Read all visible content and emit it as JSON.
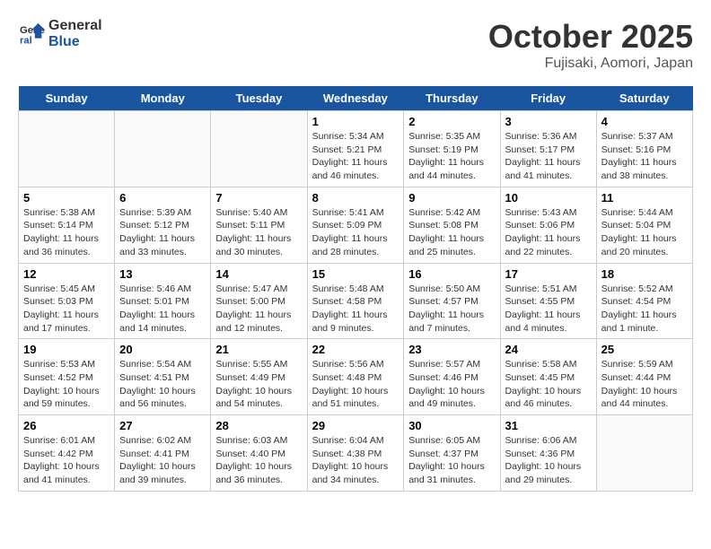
{
  "logo": {
    "text_general": "General",
    "text_blue": "Blue"
  },
  "title": "October 2025",
  "subtitle": "Fujisaki, Aomori, Japan",
  "headers": [
    "Sunday",
    "Monday",
    "Tuesday",
    "Wednesday",
    "Thursday",
    "Friday",
    "Saturday"
  ],
  "weeks": [
    [
      {
        "day": "",
        "content": ""
      },
      {
        "day": "",
        "content": ""
      },
      {
        "day": "",
        "content": ""
      },
      {
        "day": "1",
        "content": "Sunrise: 5:34 AM\nSunset: 5:21 PM\nDaylight: 11 hours and 46 minutes."
      },
      {
        "day": "2",
        "content": "Sunrise: 5:35 AM\nSunset: 5:19 PM\nDaylight: 11 hours and 44 minutes."
      },
      {
        "day": "3",
        "content": "Sunrise: 5:36 AM\nSunset: 5:17 PM\nDaylight: 11 hours and 41 minutes."
      },
      {
        "day": "4",
        "content": "Sunrise: 5:37 AM\nSunset: 5:16 PM\nDaylight: 11 hours and 38 minutes."
      }
    ],
    [
      {
        "day": "5",
        "content": "Sunrise: 5:38 AM\nSunset: 5:14 PM\nDaylight: 11 hours and 36 minutes."
      },
      {
        "day": "6",
        "content": "Sunrise: 5:39 AM\nSunset: 5:12 PM\nDaylight: 11 hours and 33 minutes."
      },
      {
        "day": "7",
        "content": "Sunrise: 5:40 AM\nSunset: 5:11 PM\nDaylight: 11 hours and 30 minutes."
      },
      {
        "day": "8",
        "content": "Sunrise: 5:41 AM\nSunset: 5:09 PM\nDaylight: 11 hours and 28 minutes."
      },
      {
        "day": "9",
        "content": "Sunrise: 5:42 AM\nSunset: 5:08 PM\nDaylight: 11 hours and 25 minutes."
      },
      {
        "day": "10",
        "content": "Sunrise: 5:43 AM\nSunset: 5:06 PM\nDaylight: 11 hours and 22 minutes."
      },
      {
        "day": "11",
        "content": "Sunrise: 5:44 AM\nSunset: 5:04 PM\nDaylight: 11 hours and 20 minutes."
      }
    ],
    [
      {
        "day": "12",
        "content": "Sunrise: 5:45 AM\nSunset: 5:03 PM\nDaylight: 11 hours and 17 minutes."
      },
      {
        "day": "13",
        "content": "Sunrise: 5:46 AM\nSunset: 5:01 PM\nDaylight: 11 hours and 14 minutes."
      },
      {
        "day": "14",
        "content": "Sunrise: 5:47 AM\nSunset: 5:00 PM\nDaylight: 11 hours and 12 minutes."
      },
      {
        "day": "15",
        "content": "Sunrise: 5:48 AM\nSunset: 4:58 PM\nDaylight: 11 hours and 9 minutes."
      },
      {
        "day": "16",
        "content": "Sunrise: 5:50 AM\nSunset: 4:57 PM\nDaylight: 11 hours and 7 minutes."
      },
      {
        "day": "17",
        "content": "Sunrise: 5:51 AM\nSunset: 4:55 PM\nDaylight: 11 hours and 4 minutes."
      },
      {
        "day": "18",
        "content": "Sunrise: 5:52 AM\nSunset: 4:54 PM\nDaylight: 11 hours and 1 minute."
      }
    ],
    [
      {
        "day": "19",
        "content": "Sunrise: 5:53 AM\nSunset: 4:52 PM\nDaylight: 10 hours and 59 minutes."
      },
      {
        "day": "20",
        "content": "Sunrise: 5:54 AM\nSunset: 4:51 PM\nDaylight: 10 hours and 56 minutes."
      },
      {
        "day": "21",
        "content": "Sunrise: 5:55 AM\nSunset: 4:49 PM\nDaylight: 10 hours and 54 minutes."
      },
      {
        "day": "22",
        "content": "Sunrise: 5:56 AM\nSunset: 4:48 PM\nDaylight: 10 hours and 51 minutes."
      },
      {
        "day": "23",
        "content": "Sunrise: 5:57 AM\nSunset: 4:46 PM\nDaylight: 10 hours and 49 minutes."
      },
      {
        "day": "24",
        "content": "Sunrise: 5:58 AM\nSunset: 4:45 PM\nDaylight: 10 hours and 46 minutes."
      },
      {
        "day": "25",
        "content": "Sunrise: 5:59 AM\nSunset: 4:44 PM\nDaylight: 10 hours and 44 minutes."
      }
    ],
    [
      {
        "day": "26",
        "content": "Sunrise: 6:01 AM\nSunset: 4:42 PM\nDaylight: 10 hours and 41 minutes."
      },
      {
        "day": "27",
        "content": "Sunrise: 6:02 AM\nSunset: 4:41 PM\nDaylight: 10 hours and 39 minutes."
      },
      {
        "day": "28",
        "content": "Sunrise: 6:03 AM\nSunset: 4:40 PM\nDaylight: 10 hours and 36 minutes."
      },
      {
        "day": "29",
        "content": "Sunrise: 6:04 AM\nSunset: 4:38 PM\nDaylight: 10 hours and 34 minutes."
      },
      {
        "day": "30",
        "content": "Sunrise: 6:05 AM\nSunset: 4:37 PM\nDaylight: 10 hours and 31 minutes."
      },
      {
        "day": "31",
        "content": "Sunrise: 6:06 AM\nSunset: 4:36 PM\nDaylight: 10 hours and 29 minutes."
      },
      {
        "day": "",
        "content": ""
      }
    ]
  ]
}
